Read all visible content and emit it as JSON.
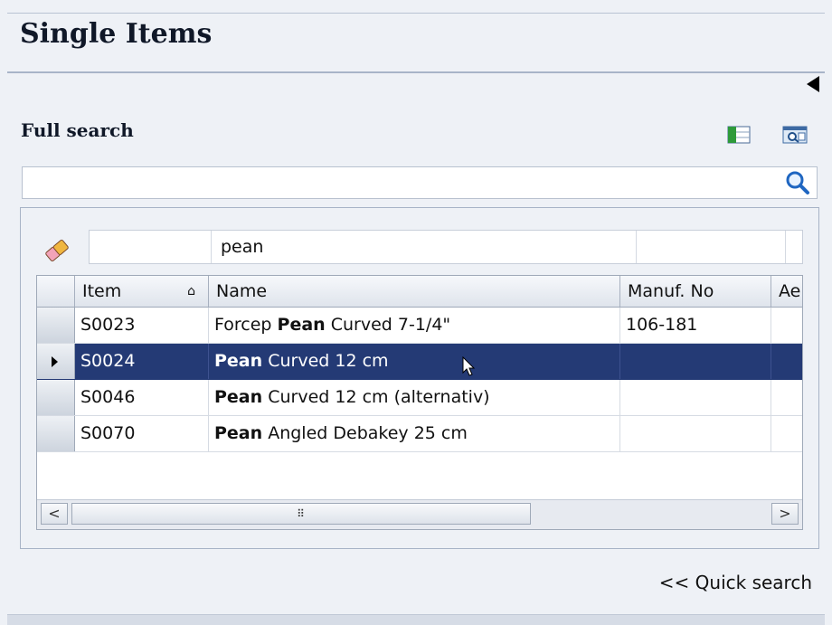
{
  "header": {
    "title": "Single Items"
  },
  "search": {
    "section_title": "Full search",
    "value": "",
    "placeholder": "",
    "filter_cells": [
      "",
      "pean",
      "",
      ""
    ]
  },
  "grid": {
    "columns": [
      {
        "label": "Item",
        "sort_icon": "up-arrow-icon"
      },
      {
        "label": "Name"
      },
      {
        "label": "Manuf. No"
      },
      {
        "label": "Ae"
      }
    ],
    "rows": [
      {
        "item": "S0023",
        "name_prefix": "Forcep ",
        "name_bold": "Pean",
        "name_suffix": " Curved 7-1/4\"",
        "manuf_no": "106-181",
        "ae": "",
        "selected": false
      },
      {
        "item": "S0024",
        "name_prefix": "",
        "name_bold": "Pean",
        "name_suffix": " Curved 12 cm",
        "manuf_no": "",
        "ae": "",
        "selected": true
      },
      {
        "item": "S0046",
        "name_prefix": "",
        "name_bold": "Pean",
        "name_suffix": " Curved 12 cm (alternativ)",
        "manuf_no": "",
        "ae": "",
        "selected": false
      },
      {
        "item": "S0070",
        "name_prefix": "",
        "name_bold": "Pean",
        "name_suffix": " Angled Debakey 25 cm",
        "manuf_no": "",
        "ae": "",
        "selected": false
      }
    ],
    "scroll_left": "<",
    "scroll_right": ">",
    "scroll_grip": "⠿"
  },
  "footer": {
    "quick_search_label": "<< Quick search"
  },
  "colors": {
    "selection": "#243a75",
    "accent": "#1f66c1",
    "background": "#eef1f6"
  },
  "icons": [
    "collapse-arrow-icon",
    "column-chooser-icon",
    "find-preview-icon",
    "search-icon",
    "eraser-icon"
  ]
}
